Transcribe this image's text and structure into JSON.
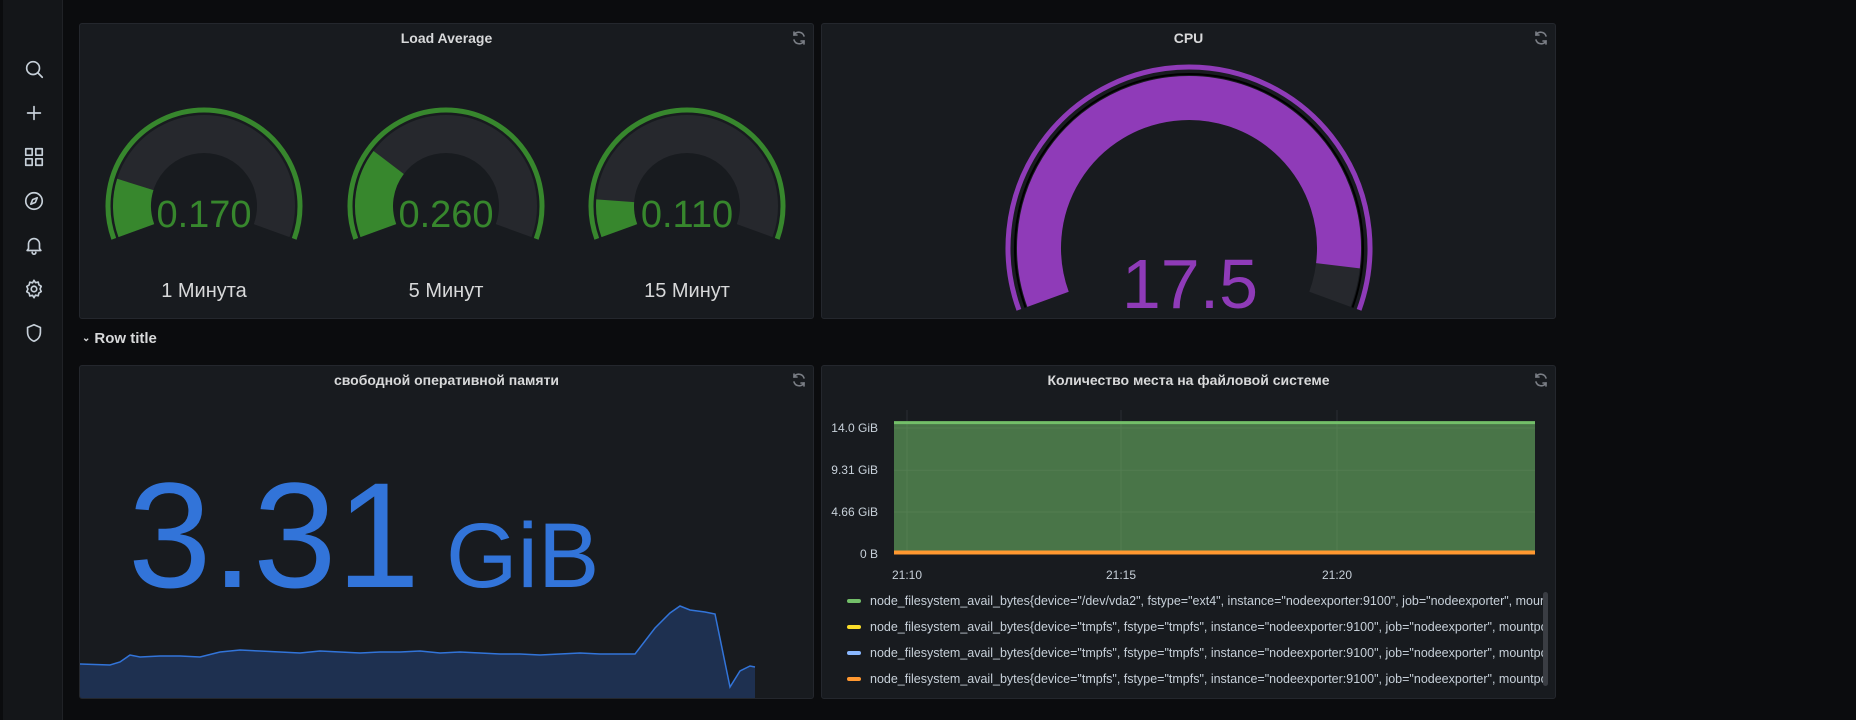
{
  "sidebar": {
    "items": [
      {
        "icon": "search-icon"
      },
      {
        "icon": "plus-icon"
      },
      {
        "icon": "dashboards-icon"
      },
      {
        "icon": "compass-icon"
      },
      {
        "icon": "bell-icon"
      },
      {
        "icon": "gear-icon"
      },
      {
        "icon": "shield-icon"
      }
    ]
  },
  "panels": {
    "load_average": {
      "title": "Load Average",
      "gauges": [
        {
          "value": "0.170",
          "label": "1 Минута",
          "fraction": 0.17
        },
        {
          "value": "0.260",
          "label": "5 Минут",
          "fraction": 0.26
        },
        {
          "value": "0.110",
          "label": "15 Минут",
          "fraction": 0.11
        }
      ],
      "color": "#37872d"
    },
    "cpu": {
      "title": "CPU",
      "value": "17.5",
      "fraction": 0.94,
      "color": "#8f3bb8"
    },
    "row": {
      "title": "Row title"
    },
    "memory": {
      "title": "свободной оперативной памяти",
      "value": "3.31",
      "unit": "GiB",
      "color": "#3274d9"
    },
    "filesystem": {
      "title": "Количество места на файловой системе",
      "y_ticks": [
        "14.0 GiB",
        "9.31 GiB",
        "4.66 GiB",
        "0 B"
      ],
      "x_ticks": [
        "21:10",
        "21:15",
        "21:20"
      ],
      "legend": [
        {
          "text": "node_filesystem_avail_bytes{device=\"/dev/vda2\", fstype=\"ext4\", instance=\"nodeexporter:9100\", job=\"nodeexporter\", mountpoint=\"/",
          "color": "#73bf69"
        },
        {
          "text": "node_filesystem_avail_bytes{device=\"tmpfs\", fstype=\"tmpfs\", instance=\"nodeexporter:9100\", job=\"nodeexporter\", mountpoint=\"/r",
          "color": "#fade2a"
        },
        {
          "text": "node_filesystem_avail_bytes{device=\"tmpfs\", fstype=\"tmpfs\", instance=\"nodeexporter:9100\", job=\"nodeexporter\", mountpoint=\"/r",
          "color": "#8ab8ff"
        },
        {
          "text": "node_filesystem_avail_bytes{device=\"tmpfs\", fstype=\"tmpfs\", instance=\"nodeexporter:9100\", job=\"nodeexporter\", mountpoint=\"/",
          "color": "#ff9830"
        }
      ]
    }
  },
  "chart_data": {
    "type": "area",
    "x": [
      "21:10",
      "21:15",
      "21:20"
    ],
    "ylabel": "",
    "ylim": [
      0,
      14.0
    ],
    "y_unit": "GiB",
    "series": [
      {
        "name": "node_filesystem_avail_bytes{device=\"/dev/vda2\", fstype=\"ext4\", instance=\"nodeexporter:9100\", job=\"nodeexporter\", mountpoint=\"/",
        "values": [
          14.6,
          14.6,
          14.6
        ]
      },
      {
        "name": "node_filesystem_avail_bytes{device=\"tmpfs\", fstype=\"tmpfs\", instance=\"nodeexporter:9100\", job=\"nodeexporter\", mountpoint=\"/r",
        "values": [
          0.1,
          0.1,
          0.1
        ]
      },
      {
        "name": "node_filesystem_avail_bytes{device=\"tmpfs\", fstype=\"tmpfs\", instance=\"nodeexporter:9100\", job=\"nodeexporter\", mountpoint=\"/r",
        "values": [
          0.1,
          0.1,
          0.1
        ]
      },
      {
        "name": "node_filesystem_avail_bytes{device=\"tmpfs\", fstype=\"tmpfs\", instance=\"nodeexporter:9100\", job=\"nodeexporter\", mountpoint=\"/",
        "values": [
          0.1,
          0.1,
          0.1
        ]
      }
    ],
    "grid": true,
    "legend_position": "bottom"
  }
}
